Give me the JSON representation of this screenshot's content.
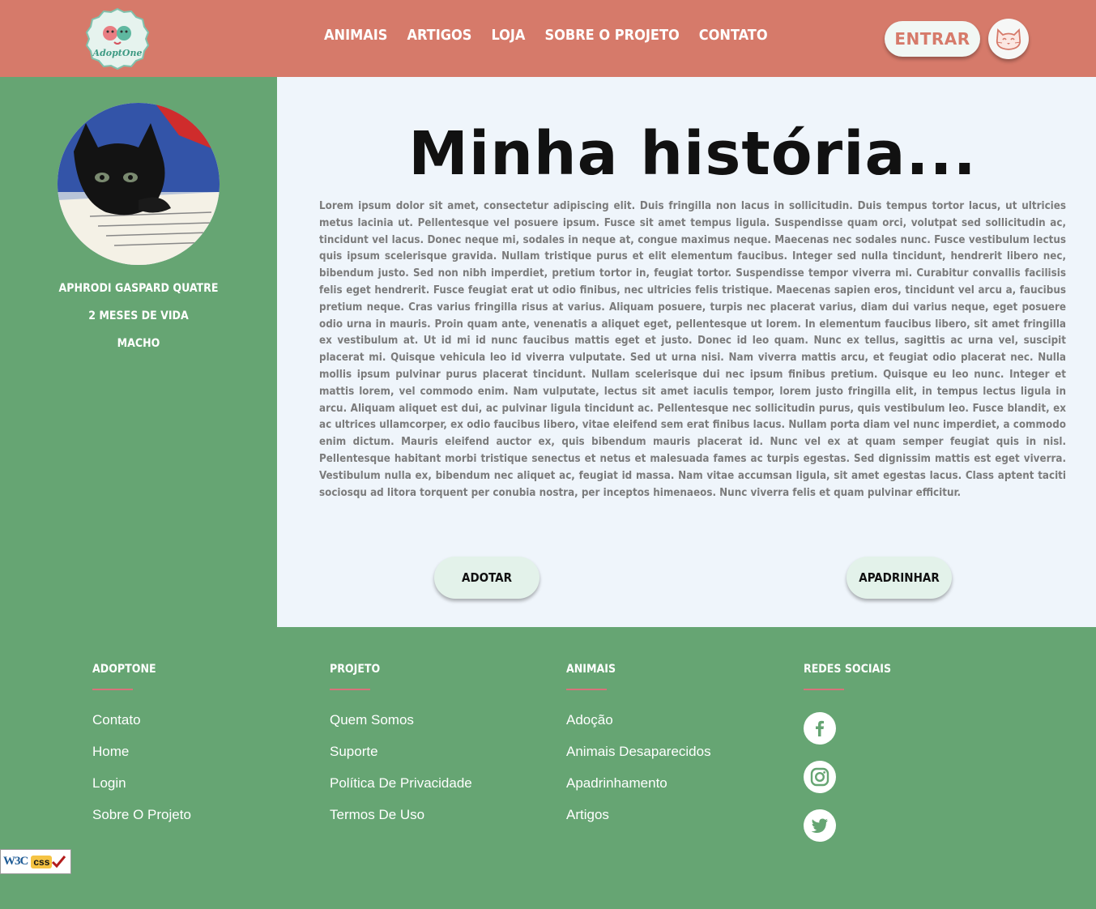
{
  "header": {
    "logo_text": "AdoptOne",
    "nav": [
      "ANIMAIS",
      "ARTIGOS",
      "LOJA",
      "SOBRE O PROJETO",
      "CONTATO"
    ],
    "login_label": "ENTRAR",
    "user_icon": "cat-face-icon"
  },
  "pet": {
    "name": "APHRODI GASPARD QUATRE",
    "age": "2 MESES DE VIDA",
    "sex": "MACHO",
    "photo": "black kitten on open book"
  },
  "main": {
    "title": "Minha história...",
    "story": "Lorem ipsum dolor sit amet, consectetur adipiscing elit. Duis fringilla non lacus in sollicitudin. Duis tempus tortor lacus, ut ultricies metus lacinia ut. Pellentesque vel posuere ipsum. Fusce sit amet tempus ligula. Suspendisse quam orci, volutpat sed sollicitudin ac, tincidunt vel lacus. Donec neque mi, sodales in neque at, congue maximus neque. Maecenas nec sodales nunc. Fusce vestibulum lectus quis ipsum scelerisque gravida. Nullam tristique purus et elit elementum faucibus. Integer sed nulla tincidunt, hendrerit libero nec, bibendum justo. Sed non nibh imperdiet, pretium tortor in, feugiat tortor. Suspendisse tempor viverra mi. Curabitur convallis facilisis felis eget hendrerit. Fusce feugiat erat ut odio finibus, nec ultricies felis tristique. Maecenas sapien eros, tincidunt vel arcu a, faucibus pretium neque. Cras varius fringilla risus at varius. Aliquam posuere, turpis nec placerat varius, diam dui varius neque, eget posuere odio urna in mauris. Proin quam ante, venenatis a aliquet eget, pellentesque ut lorem. In elementum faucibus libero, sit amet fringilla ex vestibulum at. Ut id mi id nunc faucibus mattis eget et justo. Donec id leo quam. Nunc ex tellus, sagittis ac urna vel, suscipit placerat mi. Quisque vehicula leo id viverra vulputate. Sed ut urna nisi. Nam viverra mattis arcu, et feugiat odio placerat nec. Nulla mollis ipsum pulvinar purus placerat tincidunt. Nullam scelerisque dui nec ipsum finibus pretium. Quisque eu leo nunc. Integer et mattis lorem, vel commodo enim. Nam vulputate, lectus sit amet iaculis tempor, lorem justo fringilla elit, in tempus lectus ligula in arcu. Aliquam aliquet est dui, ac pulvinar ligula tincidunt ac. Pellentesque nec sollicitudin purus, quis vestibulum leo. Fusce blandit, ex ac ultrices ullamcorper, ex odio faucibus libero, vitae eleifend sem erat finibus lacus. Nullam porta diam vel nunc imperdiet, a commodo enim dictum. Mauris eleifend auctor ex, quis bibendum mauris placerat id. Nunc vel ex at quam semper feugiat quis in nisl. Pellentesque habitant morbi tristique senectus et netus et malesuada fames ac turpis egestas. Sed dignissim mattis est eget viverra. Vestibulum nulla ex, bibendum nec aliquet ac, feugiat id massa. Nam vitae accumsan ligula, sit amet egestas lacus. Class aptent taciti sociosqu ad litora torquent per conubia nostra, per inceptos himenaeos. Nunc viverra felis et quam pulvinar efficitur.",
    "adopt_label": "ADOTAR",
    "sponsor_label": "APADRINHAR"
  },
  "footer": {
    "columns": [
      {
        "title": "ADOPTONE",
        "links": [
          "Contato",
          "Home",
          "Login",
          "Sobre O Projeto"
        ]
      },
      {
        "title": "PROJETO",
        "links": [
          "Quem Somos",
          "Suporte",
          "Política De Privacidade",
          "Termos De Uso"
        ]
      },
      {
        "title": "ANIMAIS",
        "links": [
          "Adoção",
          "Animais Desaparecidos",
          "Apadrinhamento",
          "Artigos"
        ]
      },
      {
        "title": "REDES SOCIAIS",
        "social": [
          "facebook-icon",
          "instagram-icon",
          "twitter-icon"
        ]
      }
    ],
    "badge_w3": "W3C",
    "badge_css": "css"
  },
  "colors": {
    "header": "#d67a6a",
    "green": "#66a573",
    "panel": "#eff5fb",
    "accent_line": "#d6737a",
    "button": "#e3f2ea"
  }
}
